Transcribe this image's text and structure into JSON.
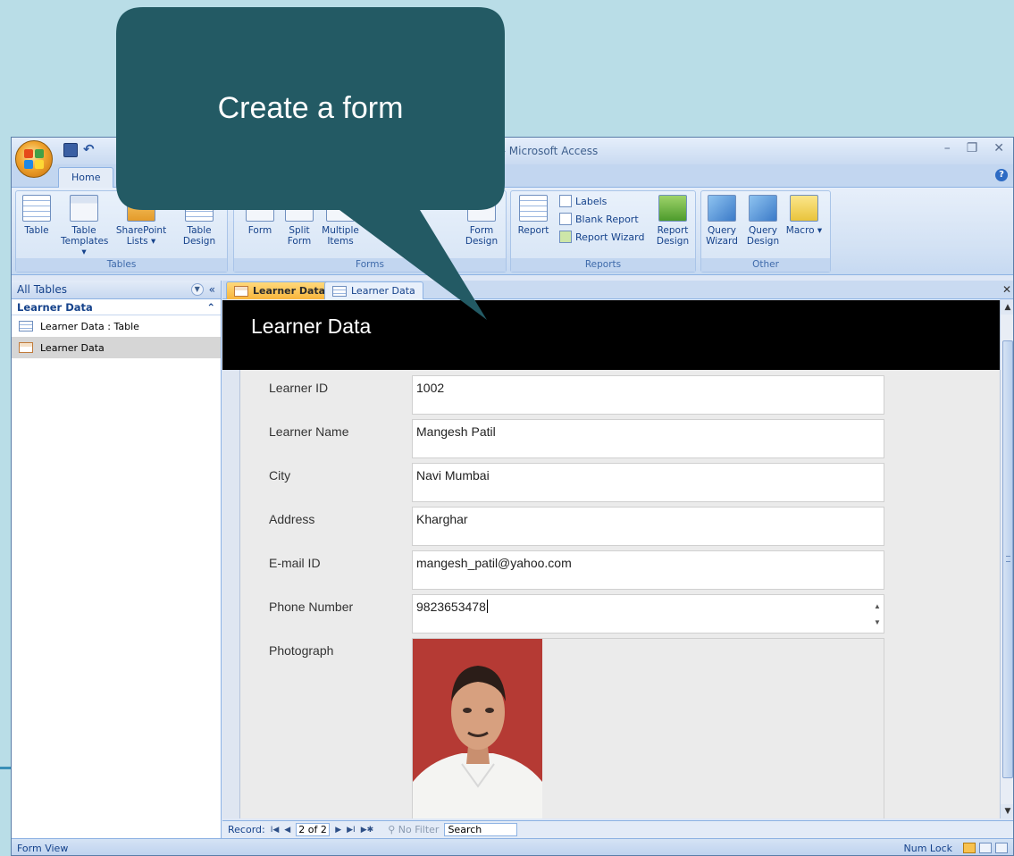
{
  "callout": {
    "text": "Create a form"
  },
  "window": {
    "title": "Access 2007) - Microsoft Access",
    "tab_home": "Home"
  },
  "ribbon": {
    "tables": {
      "label": "Tables",
      "table": "Table",
      "templates": "Table Templates ▾",
      "sharepoint": "SharePoint Lists ▾",
      "design": "Table Design"
    },
    "forms": {
      "label": "Forms",
      "form": "Form",
      "split": "Split Form",
      "multiple": "Multiple Items",
      "form_design": "Form Design"
    },
    "reports": {
      "label": "Reports",
      "report": "Report",
      "labels": "Labels",
      "blank": "Blank Report",
      "wizard": "Report Wizard",
      "design": "Report Design"
    },
    "other": {
      "label": "Other",
      "query_wizard": "Query Wizard",
      "query_design": "Query Design",
      "macro": "Macro ▾"
    }
  },
  "nav": {
    "header": "All Tables",
    "group": "Learner Data",
    "items": [
      {
        "label": "Learner Data : Table",
        "icon": "table-icon"
      },
      {
        "label": "Learner Data",
        "icon": "form-icon"
      }
    ]
  },
  "doc_tabs": [
    {
      "label": "Learner Data",
      "icon": "form-icon",
      "active": true
    },
    {
      "label": "Learner Data",
      "icon": "table-icon",
      "active": false
    }
  ],
  "form": {
    "title": "Learner Data",
    "fields": [
      {
        "label": "Learner ID",
        "value": "1002"
      },
      {
        "label": "Learner Name",
        "value": "Mangesh Patil"
      },
      {
        "label": "City",
        "value": "Navi Mumbai"
      },
      {
        "label": "Address",
        "value": "Kharghar"
      },
      {
        "label": "E-mail ID",
        "value": "mangesh_patil@yahoo.com"
      },
      {
        "label": "Phone Number",
        "value": "9823653478"
      },
      {
        "label": "Photograph",
        "value": ""
      }
    ]
  },
  "record_nav": {
    "prefix": "Record:",
    "current": "2 of 2",
    "filter": "No Filter",
    "search": "Search"
  },
  "status": {
    "left": "Form View",
    "right": "Num Lock"
  }
}
